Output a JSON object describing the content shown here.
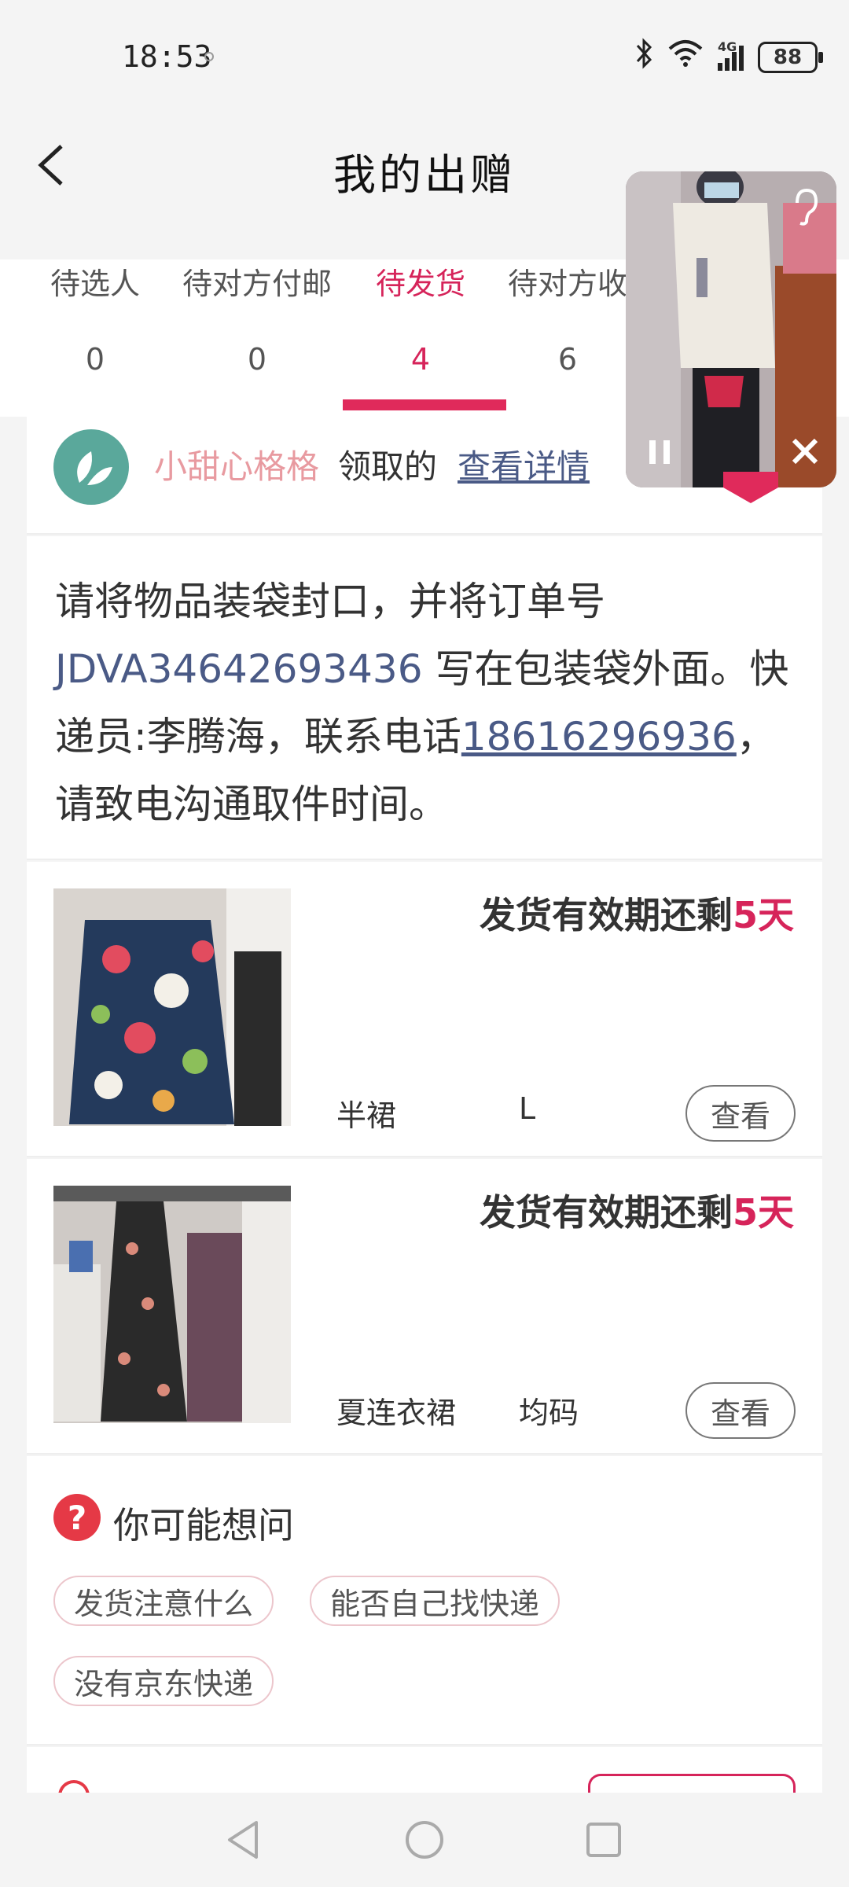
{
  "status_bar": {
    "time": "18:53",
    "network": "4G",
    "battery": "88"
  },
  "header": {
    "title": "我的出赠"
  },
  "tabs": [
    {
      "label": "待选人",
      "count": "0"
    },
    {
      "label": "待对方付邮",
      "count": "0"
    },
    {
      "label": "待发货",
      "count": "4"
    },
    {
      "label": "待对方收",
      "count": "6"
    }
  ],
  "claim": {
    "user": "小甜心格格",
    "text": "领取的",
    "link": "查看详情"
  },
  "notice": {
    "part1": "请将物品装袋封口，并将订单号 ",
    "order_no": "JDVA34642693436",
    "part2": " 写在包装袋外面。快递员:李腾海，联系电话",
    "phone": "18616296936",
    "part3": "，请致电沟通取件时间。"
  },
  "items": [
    {
      "deadline_prefix": "发货有效期还剩",
      "deadline_days": "5天",
      "name": "半裙",
      "size": "L",
      "button": "查看"
    },
    {
      "deadline_prefix": "发货有效期还剩",
      "deadline_days": "5天",
      "name": "夏连衣裙",
      "size": "均码",
      "button": "查看"
    }
  ],
  "faq": {
    "title": "你可能想问",
    "chips": [
      "发货注意什么",
      "能否自己找快递",
      "没有京东快递"
    ]
  },
  "colors": {
    "accent": "#d6245a",
    "link": "#4a5a86",
    "claim_user": "#e89aa0"
  }
}
